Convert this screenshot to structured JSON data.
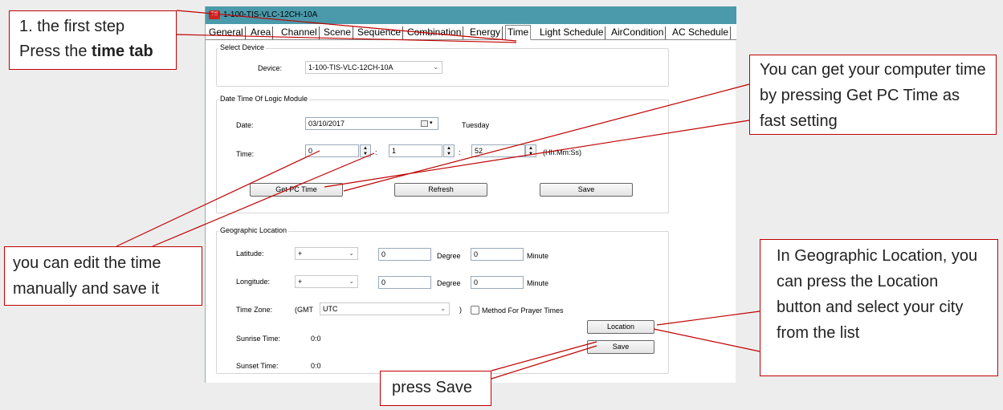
{
  "window": {
    "title": "1-100-TIS-VLC-12CH-10A",
    "logo_text": "TIS"
  },
  "tabs": [
    "General",
    "Area",
    "Channel",
    "Scene",
    "Sequence",
    "Combination",
    "Energy",
    "Time",
    "Light Schedule",
    "AirCondition",
    "AC Schedule"
  ],
  "active_tab": "Time",
  "select_device": {
    "group_title": "Select Device",
    "device_label": "Device:",
    "device_value": "1-100-TIS-VLC-12CH-10A"
  },
  "datetime": {
    "group_title": "Date Time Of Logic Module",
    "date_label": "Date:",
    "date_value": "03/10/2017",
    "weekday": "Tuesday",
    "time_label": "Time:",
    "hours": "0",
    "minutes": "1",
    "seconds": "52",
    "sep": ":",
    "format_hint": "(Hh:Mm:Ss)",
    "get_pc_time": "Get PC Time",
    "refresh": "Refresh",
    "save": "Save"
  },
  "geo": {
    "group_title": "Geographic Location",
    "latitude_label": "Latitude:",
    "latitude_sign": "+",
    "latitude_degree": "0",
    "latitude_minute": "0",
    "longitude_label": "Longitude:",
    "longitude_sign": "+",
    "longitude_degree": "0",
    "longitude_minute": "0",
    "degree_label": "Degree",
    "minute_label": "Minute",
    "timezone_label": "Time Zone:",
    "gmt_prefix": "(GMT",
    "timezone_value": "UTC",
    "gmt_suffix": ")",
    "prayer_label": "Method For Prayer Times",
    "prayer_checked": false,
    "location_button": "Location",
    "save_button": "Save",
    "sunrise_label": "Sunrise Time:",
    "sunrise_value": "0:0",
    "sunset_label": "Sunset Time:",
    "sunset_value": "0:0"
  },
  "callouts": {
    "first_step_line1": "1. the first step",
    "first_step_line2_prefix": "Press the ",
    "first_step_line2_bold": "time tab",
    "pc_time": "You can get your computer time by pressing Get PC Time as fast setting",
    "manual": "you can edit the time manually and save it",
    "geo": "In Geographic Location, you can press the Location button and select your city from the list",
    "save": "press Save"
  },
  "colors": {
    "titlebar": "#4a9aab",
    "annotation_red": "#c00000"
  }
}
